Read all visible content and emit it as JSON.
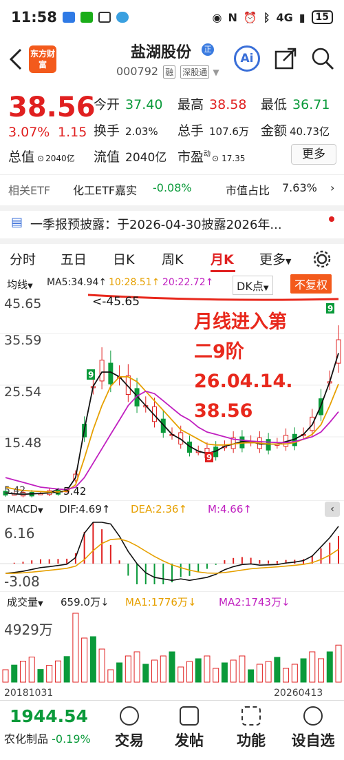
{
  "status_bar": {
    "time": "11:58",
    "network": "4G",
    "battery": "15"
  },
  "header": {
    "stock_name": "盐湖股份",
    "badge": "正",
    "code": "000792",
    "tag1": "融",
    "tag2": "深股通",
    "logo_text": "东方财富",
    "ai_label": "Ai"
  },
  "quote": {
    "price": "38.56",
    "change_pct": "3.07%",
    "change": "1.15",
    "open_label": "今开",
    "open": "37.40",
    "high_label": "最高",
    "high": "38.58",
    "low_label": "最低",
    "low": "36.71",
    "turnover_label": "换手",
    "turnover": "2.03%",
    "volume_label": "总手",
    "volume": "107.6万",
    "amount_label": "金额",
    "amount": "40.73亿",
    "mcap_label": "总值",
    "mcap": "2040亿",
    "float_label": "流值",
    "float": "2040亿",
    "pe_label": "市盈",
    "pe_sup": "动",
    "pe": "17.35",
    "more_btn": "更多"
  },
  "etf": {
    "label": "相关ETF",
    "name": "化工ETF嘉实",
    "change": "-0.08%",
    "ratio_label": "市值占比",
    "ratio": "7.63%"
  },
  "notice": {
    "text": "一季报预披露：于2026-04-30披露2026年..."
  },
  "tabs": [
    {
      "label": "分时"
    },
    {
      "label": "五日"
    },
    {
      "label": "日K"
    },
    {
      "label": "周K"
    },
    {
      "label": "月K"
    },
    {
      "label": "更多"
    }
  ],
  "kline_bar": {
    "ma_type": "均线",
    "ma5": "MA5:34.94↑",
    "ma10": "10:28.51↑",
    "ma20": "20:22.72↑",
    "dk": "DK点",
    "adjust": "不复权"
  },
  "price_axis": {
    "p1": "45.65",
    "p2": "35.59",
    "p3": "25.54",
    "p4": "15.48",
    "p5": "5.42"
  },
  "annotations": {
    "max_label": "<-45.65",
    "min_label": "<-5.42",
    "handwritten": [
      "月线进入第",
      "二9阶",
      "26.04.14.",
      "38.56"
    ]
  },
  "td_labels": {
    "up_seq1": "123456789",
    "top9": "9",
    "down_seq": "123456789",
    "down9": "9",
    "recent_up": "123456789"
  },
  "macd_bar": {
    "label": "MACD",
    "dif": "DIF:4.69↑",
    "dea": "DEA:2.36↑",
    "m": "M:4.66↑",
    "max": "6.16",
    "min": "-3.08"
  },
  "vol_bar": {
    "label": "成交量",
    "vol": "659.0万↓",
    "ma1": "MA1:1776万↓",
    "ma2": "MA2:1743万↓",
    "max": "4929万"
  },
  "dates": {
    "start": "20181031",
    "end": "20260413"
  },
  "bottom": {
    "index_value": "1944.54",
    "index_name": "农化制品",
    "index_change": "-0.19%",
    "trade": "交易",
    "post": "发帖",
    "func": "功能",
    "settings": "设自选"
  },
  "colors": {
    "up": "#e02020",
    "down": "#0a9a3a",
    "ma5": "#111111",
    "ma10": "#e6a000",
    "ma20": "#c020c0"
  },
  "chart_data": {
    "type": "candlestick",
    "series": [
      {
        "name": "MA5",
        "values": [
          5.8,
          5.6,
          5.5,
          5.6,
          5.7,
          5.8,
          6.0,
          6.3,
          9.0,
          19,
          28,
          31,
          31,
          30,
          28,
          26,
          24,
          22,
          20,
          18,
          17,
          15.5,
          14.5,
          14,
          14.5,
          15.5,
          16,
          16.5,
          16.5,
          16,
          16,
          16,
          16.5,
          17,
          18,
          20,
          24,
          29,
          34.94
        ]
      },
      {
        "name": "MA10",
        "values": [
          7,
          6.6,
          6.3,
          6.2,
          6.1,
          6.0,
          6.0,
          6.2,
          7.5,
          13,
          19,
          24,
          28,
          30,
          30,
          29,
          27,
          25,
          23,
          21,
          19,
          18,
          17,
          16,
          15.8,
          15.8,
          16,
          16.2,
          16.3,
          16.2,
          16,
          16,
          16,
          16.3,
          17,
          18,
          20,
          24,
          28.51
        ]
      },
      {
        "name": "MA20",
        "values": [
          9,
          8.5,
          8,
          7.5,
          7,
          6.8,
          6.6,
          6.5,
          7,
          9,
          12,
          15,
          18,
          21,
          24,
          26,
          27,
          26.5,
          25,
          23.5,
          22,
          21,
          19.5,
          18.5,
          18,
          17.5,
          17,
          16.8,
          16.6,
          16.5,
          16.4,
          16.3,
          16.3,
          16.5,
          17,
          17.5,
          18.5,
          20.5,
          22.72
        ]
      }
    ],
    "ylim": [
      5.42,
      45.65
    ],
    "macd": {
      "dif": 4.69,
      "dea": 2.36,
      "m": 4.66,
      "ylim": [
        -3.08,
        6.16
      ]
    },
    "volume": {
      "max": "4929万",
      "last": "659.0万"
    }
  }
}
